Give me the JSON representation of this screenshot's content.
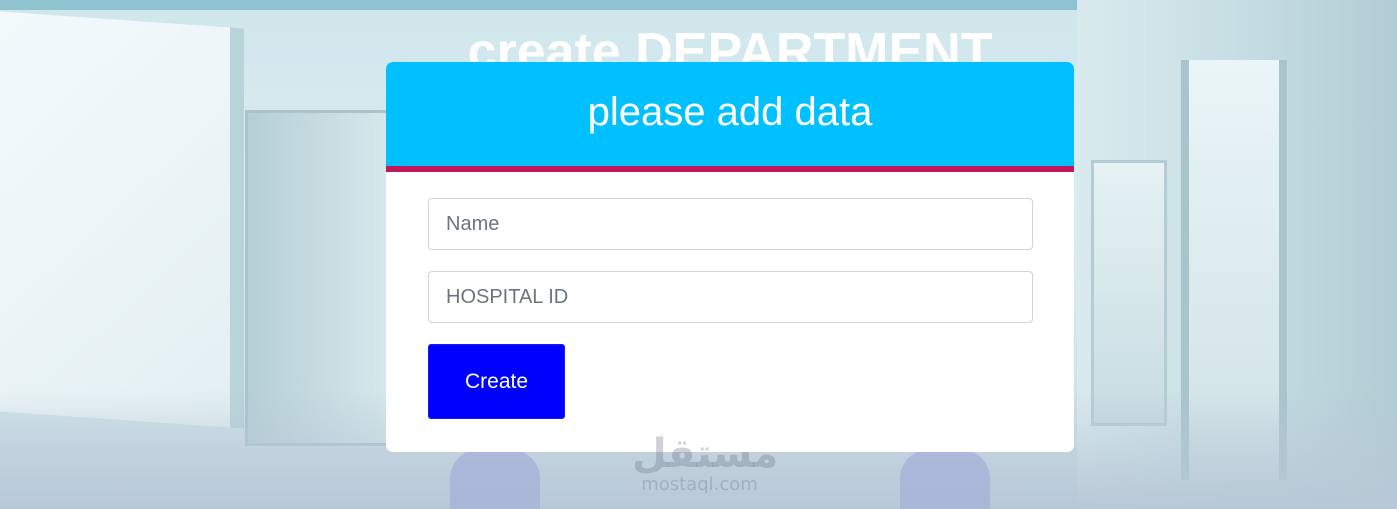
{
  "page": {
    "title": "create DEPARTMENT"
  },
  "form": {
    "header_title": "please add data",
    "name_placeholder": "Name",
    "hospital_id_placeholder": "HOSPITAL ID",
    "submit_label": "Create"
  },
  "watermark": {
    "logo_text": "مستقل",
    "site_text": "mostaql.com"
  },
  "colors": {
    "header_bg": "#00c0ff",
    "header_border": "#c2185b",
    "button_bg": "#0000ff",
    "card_bg": "#ffffff"
  }
}
